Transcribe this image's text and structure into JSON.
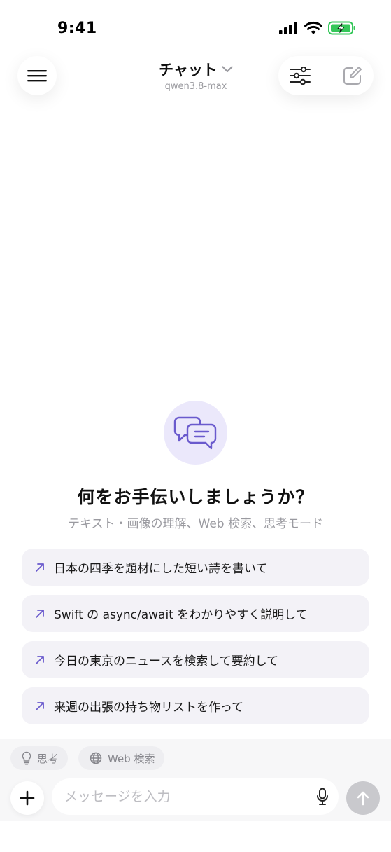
{
  "status_bar": {
    "time": "9:41"
  },
  "header": {
    "title": "チャット",
    "model": "qwen3.8-max"
  },
  "empty_state": {
    "title": "何をお手伝いしましょうか？",
    "subtitle": "テキスト・画像の理解、Web 検索、思考モード"
  },
  "suggestions": [
    {
      "label": "日本の四季を題材にした短い詩を書いて"
    },
    {
      "label": "Swift の async/await をわかりやすく説明して"
    },
    {
      "label": "今日の東京のニュースを検索して要約して"
    },
    {
      "label": "来週の出張の持ち物リストを作って"
    }
  ],
  "composer": {
    "chips": [
      {
        "label": "思考",
        "icon": "lightbulb-icon"
      },
      {
        "label": "Web 検索",
        "icon": "globe-icon"
      }
    ],
    "placeholder": "メッセージを入力",
    "value": ""
  },
  "colors": {
    "accent": "#6a5acd",
    "accent_soft": "#ebe8fb",
    "chip_bg": "#eeeef1",
    "suggestion_bg": "#f3f2f7",
    "send_disabled": "#c9c9cd",
    "battery_green": "#34c759"
  }
}
